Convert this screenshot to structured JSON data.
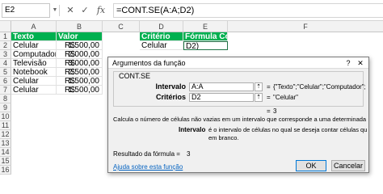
{
  "formula_bar": {
    "name_box": "E2",
    "cancel_glyph": "✕",
    "enter_glyph": "✓",
    "fx_glyph": "fx",
    "formula": "=CONT.SE(A:A;D2)"
  },
  "columns": [
    "A",
    "B",
    "C",
    "D",
    "E",
    "F"
  ],
  "rows": [
    "1",
    "2",
    "3",
    "4",
    "5",
    "6",
    "7",
    "8",
    "9",
    "10",
    "11",
    "12",
    "13",
    "14",
    "15",
    "16"
  ],
  "sheet": {
    "a1": "Texto",
    "b1": "Valor",
    "d1": "Critério",
    "e1": "Fórmula Cont",
    "d2": "Celular",
    "e2": "D2)",
    "currency": "R$",
    "data": [
      {
        "texto": "Celular",
        "valor": "1.500,00"
      },
      {
        "texto": "Computador",
        "valor": "2.000,00"
      },
      {
        "texto": "Televisão",
        "valor": "3.000,00"
      },
      {
        "texto": "Notebook",
        "valor": "2.500,00"
      },
      {
        "texto": "Celular",
        "valor": "1.500,00"
      },
      {
        "texto": "Celular",
        "valor": "1.500,00"
      }
    ]
  },
  "dialog": {
    "title": "Argumentos da função",
    "help_glyph": "?",
    "close_glyph": "✕",
    "function_name": "CONT.SE",
    "args": [
      {
        "label": "Intervalo",
        "value": "A:A",
        "result": "{\"Texto\";\"Celular\";\"Computador\";\"Tel..."
      },
      {
        "label": "Critérios",
        "value": "D2",
        "result": "\"Celular\""
      }
    ],
    "equals": "=",
    "function_result": "3",
    "description": "Calcula o número de células não vazias em um intervalo que corresponde a uma determinada condição.",
    "arg_help_label": "Intervalo",
    "arg_help_text_1": "é o intervalo de células no qual se deseja contar células que não estão",
    "arg_help_text_2": "em branco.",
    "formula_result_label": "Resultado da fórmula =",
    "formula_result_value": "3",
    "help_link": "Ajuda sobre esta função",
    "ok_label": "OK",
    "cancel_label": "Cancelar",
    "collapse_glyph": "⇡"
  },
  "colors": {
    "header_fill": "#00b050",
    "header_text": "#ffffff",
    "link": "#0563c1"
  }
}
